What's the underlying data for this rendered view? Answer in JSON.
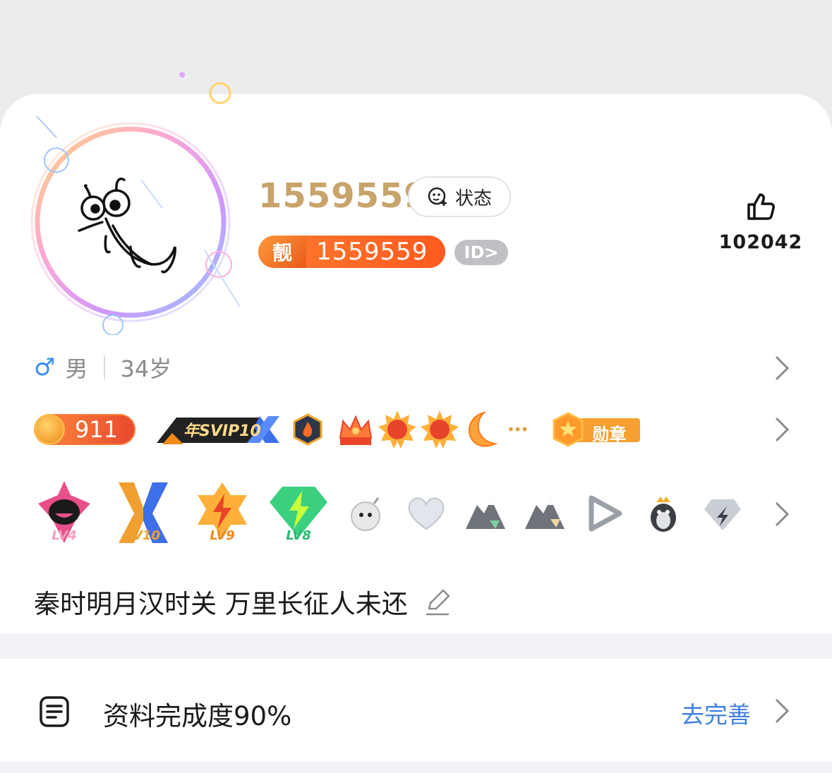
{
  "profile": {
    "nickname": "1559559",
    "status_label": "状态",
    "pretty_tag": "靓",
    "pretty_number": "1559559",
    "id_label": "ID>",
    "like_count": "102042",
    "gender": "男",
    "age": "34岁",
    "coin_count": "911",
    "svip_label": "年SVIP10",
    "medal_label": "勋章",
    "more_dots": "•••",
    "levels": [
      {
        "label": "LV4",
        "icon": "lv4-icon"
      },
      {
        "label": "LV10",
        "icon": "lv10-icon"
      },
      {
        "label": "LV9",
        "icon": "lv9-icon"
      },
      {
        "label": "LV8",
        "icon": "lv8-icon"
      }
    ],
    "signature": "秦时明月汉时关  万里长征人未还"
  },
  "completion": {
    "label": "资料完成度90%",
    "action": "去完善"
  },
  "colors": {
    "nickname": "#c8a36a",
    "accent_blue": "#3f7fe0",
    "pretty_orange": "#ff6a25",
    "gender_blue": "#3b8ff2"
  }
}
